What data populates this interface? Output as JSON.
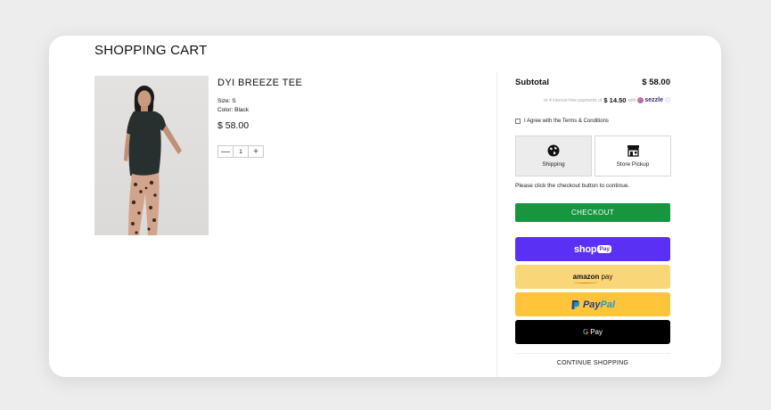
{
  "page": {
    "title": "SHOPPING CART"
  },
  "product": {
    "name": "DYI BREEZE TEE",
    "size": "Size: S",
    "color": "Color: Black",
    "price": "$ 58.00",
    "quantity": "1",
    "qty_minus": "—",
    "qty_plus": "+"
  },
  "summary": {
    "subtotal_label": "Subtotal",
    "subtotal_value": "$ 58.00",
    "sezzle_prefix": "or 4 interest-free payments of",
    "sezzle_amount": "$ 14.50",
    "sezzle_with": "with",
    "sezzle_brand": "sezzle",
    "sezzle_info": "ⓘ",
    "terms_label": "I Agree with the Terms & Conditions",
    "shipping_label": "Shipping",
    "pickup_label": "Store Pickup",
    "checkout_note": "Please click the checkout button to continue.",
    "checkout_label": "CHECKOUT",
    "shoppay_shop": "shop",
    "shoppay_pay": "Pay",
    "amazon_word": "amazon",
    "amazon_pay": "pay",
    "paypal_pay": "Pay",
    "paypal_pal": "Pal",
    "gpay_g": "G",
    "gpay_pay": "Pay",
    "continue_label": "CONTINUE SHOPPING"
  },
  "colors": {
    "checkout": "#17953f",
    "shop_pay": "#5a31f4",
    "amazon_pay": "#f9d677",
    "paypal": "#ffc43a",
    "google_pay": "#000000"
  },
  "icons": {
    "shipping": "globe-icon",
    "pickup": "storefront-icon"
  }
}
